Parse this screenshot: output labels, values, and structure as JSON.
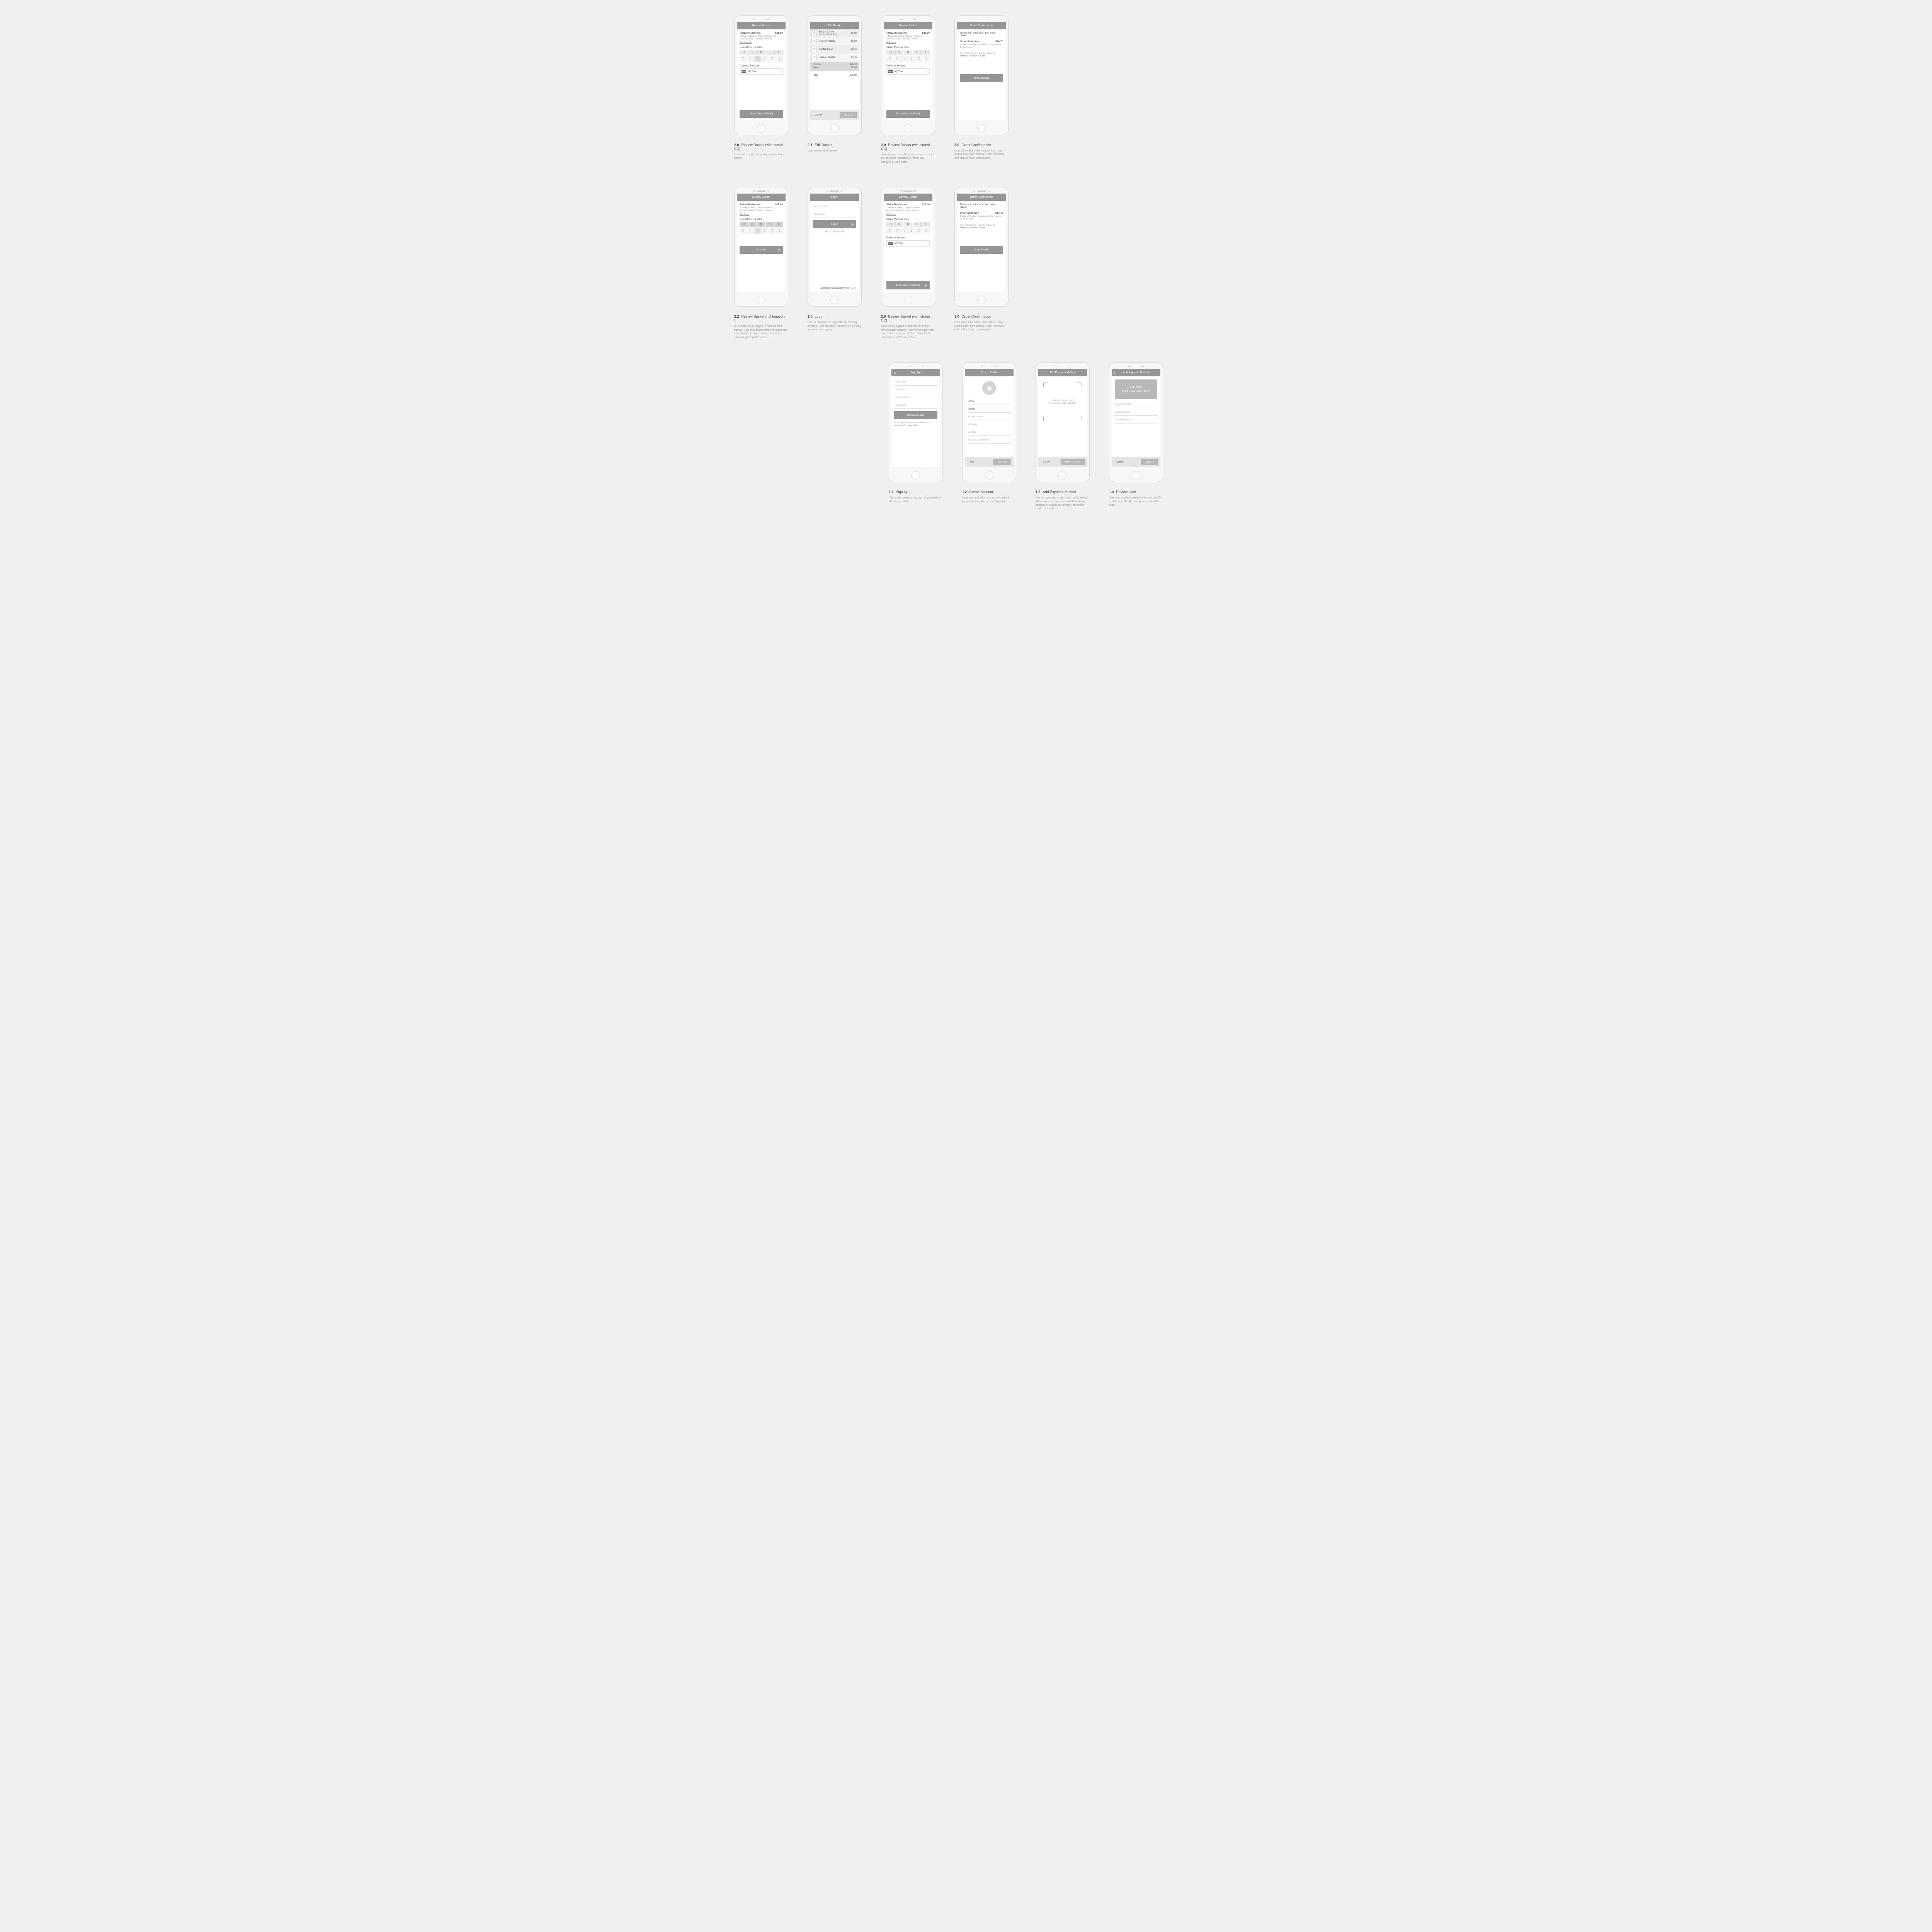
{
  "row1": [
    {
      "title": "Review Basket",
      "restaurant": "Africa Restaurant",
      "total": "$29.80",
      "items_summary": "1 Burger Combo, 1 Original Poutine,\n2 Garden Salad, 2 Bottles of Nestea",
      "edit_link": "Edit Order",
      "pickup_label": "Select Pick Up Time",
      "times": [
        "10",
        "11",
        "12",
        "1",
        "2"
      ],
      "statuses_top": [
        "48",
        "14",
        "19",
        "41",
        "48",
        "44"
      ],
      "statuses": [
        "✓",
        "✓",
        "✓",
        "✓",
        "✕",
        "✕"
      ],
      "payment_label": "Payment Method",
      "payment_name": "My Visa",
      "place_btn": "Place Order ($29.80)",
      "cap_num": "2.0",
      "cap_title": "Review Basket (with stored CC)",
      "cap_desc": "User with credit card on file reviews their basket"
    },
    {
      "title": "Edit Basket",
      "rows": [
        {
          "qty": "1",
          "name": "Burger Combo",
          "sub": "Caesar Salad & Coke",
          "price": "$8.80"
        },
        {
          "qty": "1",
          "name": "Original Poutine",
          "sub": "",
          "price": "$6.80"
        },
        {
          "qty": "2",
          "name": "Garden Salad",
          "sub": "",
          "price": "$3.46"
        },
        {
          "qty": "2",
          "name": "Bottle of Nestea",
          "sub": "",
          "price": "$1.75"
        }
      ],
      "totals": [
        {
          "label": "Subtotal",
          "val": "$26.40"
        },
        {
          "label": "Taxes",
          "val": "$3.40"
        }
      ],
      "grand": {
        "label": "Total",
        "val": "$29.80"
      },
      "cancel": "Cancel",
      "done": "Done",
      "cap_num": "2.1",
      "cap_title": "Edit Basket",
      "cap_desc": "User revises their basket"
    },
    {
      "title": "Review Basket",
      "restaurant": "Africa Restaurant",
      "total": "$29.80",
      "items_summary": "1 Burger Combo, 1 Original Poutine,\n2 Garden Salad, 2 Bottles of Nestea",
      "edit_link": "Edit Order",
      "pickup_label": "Select Pick Up Time",
      "times": [
        "10",
        "11",
        "12",
        "1",
        "2"
      ],
      "statuses_top": [
        "48",
        "14",
        "19",
        "41",
        "48",
        "44"
      ],
      "statuses": [
        "✓",
        "✓",
        "✓",
        "✕",
        "✕",
        "✕"
      ],
      "payment_label": "Payment Method",
      "payment_name": "My Visa",
      "place_btn": "Place Order ($29.80)",
      "cap_num": "2.0",
      "cap_title": "Review Basket (with stored CC)",
      "cap_desc": "User returns to basket screen once revisions are complete, updated to reflect any changes in their order"
    },
    {
      "title": "Order Confirmation",
      "thanks": "Thank you! Your order has been placed",
      "summary_label": "Order Summary",
      "summary_total": "$14.75",
      "summary_items": "1 Original Poutine, 1 Montreal Style Poutine, 1 Can of coke",
      "ready_pre": "Your order will be ready for pick up at",
      "ready_loc": "Smoke's Poutine",
      "ready_at": " at ",
      "ready_time": "12:15",
      "details_btn": "Order Details",
      "cap_num": "3.0",
      "cap_title": "Order Confirmation",
      "cap_desc": "User places the order successfully, using stored credit card details. Order summary and pick up time is presented."
    }
  ],
  "row2": [
    {
      "title": "Review Basket",
      "restaurant": "Africa Restaurant",
      "total": "$29.80",
      "items_summary": "1 Burger Combo, 1 Original Poutine,\n2 Garden Salad, 2 Bottles of Nestea",
      "edit_link": "Edit Order",
      "pickup_label": "Select Pick Up Time",
      "times": [
        "10",
        "11",
        "12",
        "1",
        "2"
      ],
      "statuses_top": [
        "48",
        "14",
        "19",
        "41",
        "48",
        "44"
      ],
      "statuses": [
        "✓",
        "✓",
        "✓",
        "✓",
        "✕",
        "✕"
      ],
      "continue_btn": "Continue",
      "cap_num": "2.2",
      "cap_title": "Review Basket (not logged in )",
      "cap_desc": "A user that is not logged in reviews their basket. User may browse the menu and add items to their basket, but must log in to continue placing their order."
    },
    {
      "title": "Log in",
      "fields": [
        "email address",
        "password"
      ],
      "login_btn": "Log in",
      "forgot": "Forgot Password?",
      "no_account": "Don't have an account? ",
      "signup": "Sign up",
      "cap_num": "1.0",
      "cap_title": "Login",
      "cap_desc": "User is prompted to login with an existing account. User that does not have an existing account may sign up."
    },
    {
      "title": "Review Basket",
      "restaurant": "Africa Restaurant",
      "total": "$29.80",
      "items_summary": "1 Burger Combo, 1 Original Poutine,\n2 Garden Salad, 2 Bottles of Nestea",
      "edit_link": "Edit Order",
      "pickup_label": "Select Pick Up Time",
      "times": [
        "10",
        "11",
        "12",
        "1",
        "2"
      ],
      "statuses_top": [
        "48",
        "14",
        "19",
        "41",
        "48",
        "44"
      ],
      "statuses": [
        "✓",
        "✓",
        "✓",
        "✕",
        "✕",
        "✕"
      ],
      "payment_label": "Payment Method",
      "payment_name": "My Visa",
      "place_btn": "Place Order ($29.80)",
      "cap_num": "2.0",
      "cap_title": "Review Basket (with stored CC)",
      "cap_desc": "User is now logged in and returns to the review basket screen, now with stored credit card details retrieved. Refer to flow 1.1 for users with no CC info on file."
    },
    {
      "title": "Order Confirmation",
      "thanks": "Thank you! Your order has been placed",
      "summary_label": "Order Summary",
      "summary_total": "$14.75",
      "summary_items": "1 Original Poutine, 1 Montreal Style Poutine, 1 Can of coke",
      "ready_pre": "Your order will be ready for pick up at",
      "ready_loc": "Smoke's Poutine",
      "ready_at": " at ",
      "ready_time": "12:15",
      "details_btn": "Order Details",
      "cap_num": "3.0",
      "cap_title": "Order Confirmation",
      "cap_desc": "User places the order successfully, using stored credit card details. Order summary and pick up time is presented."
    }
  ],
  "row3": [
    {
      "title": "Sign Up",
      "fields": [
        "first name",
        "last name",
        "email address",
        "password"
      ],
      "create_btn": "Create Account",
      "terms": "By signing up, you agree to the terms of service and privacy policy.",
      "cap_num": "1.1",
      "cap_title": "Sign Up",
      "cap_desc": "User must create an account to proceed with placing an order."
    },
    {
      "title": "Create Profile",
      "filled": [
        "John",
        "Smith"
      ],
      "fields": [
        "phone number",
        "birthday",
        "gender",
        "dietary preferences"
      ],
      "skip": "Skip",
      "cont": "Continue",
      "cap_num": "1.2",
      "cap_title": "Create Account",
      "cap_desc": "User may add additional account details (optional - this step can be skipped)"
    },
    {
      "title": "Add Payment Method",
      "scan_hint": "Hold credit card here.\nIt will scan automatically.",
      "cancel": "Cancel",
      "enter": "Enter manually",
      "cap_num": "1.3",
      "cap_title": "Add Payment Method",
      "cap_desc": "User is prompted to add a payment method. They can scan their card with their phone camera or choose to manually enter their credit card details."
    },
    {
      "title": "Add Payment Method",
      "card_name": "John Smith",
      "card_num": "1234 5669 1231 2342",
      "fields": [
        "Expiration Date",
        "CCV Number",
        "Card Nickname"
      ],
      "cancel": "Cancel",
      "done": "Done",
      "cap_num": "1.4",
      "cap_title": "Review Card",
      "cap_desc": "User is prompted to review their card and fill in additional details not capture during the scan"
    }
  ]
}
